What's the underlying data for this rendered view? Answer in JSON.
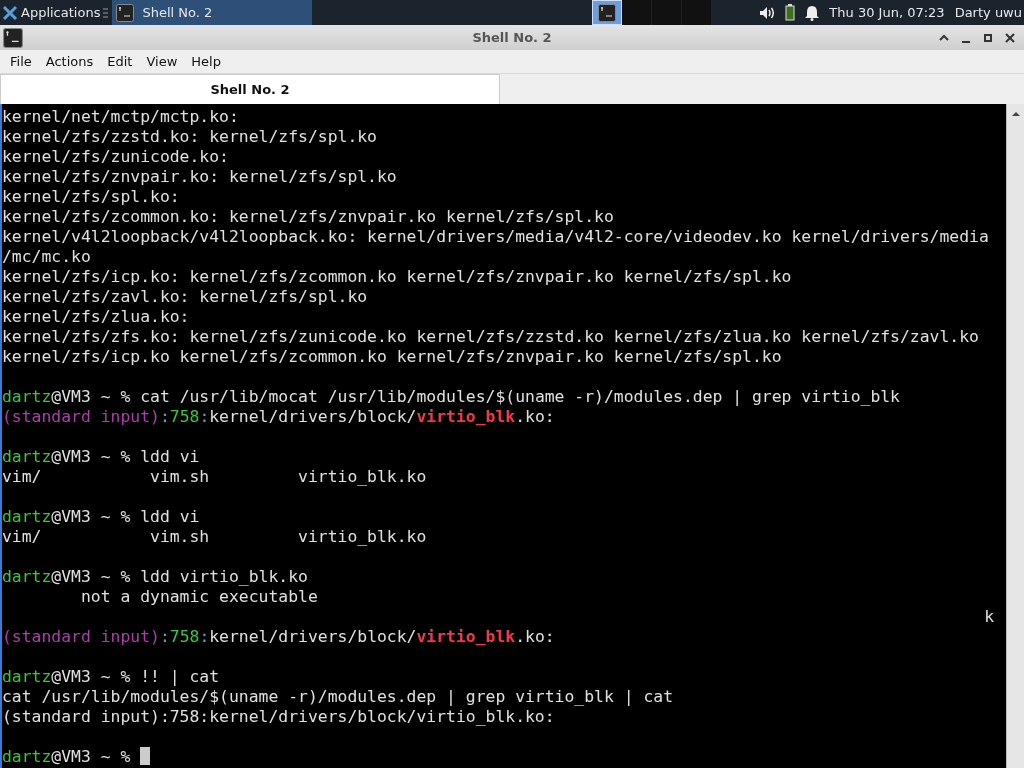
{
  "panel": {
    "apps_label": "Applications",
    "tasks": [
      {
        "label": "Shell No. 2",
        "selected": true
      }
    ],
    "workspaces": [
      {
        "selected": true
      },
      {
        "selected": false
      },
      {
        "selected": false
      },
      {
        "selected": false
      }
    ],
    "clock": "Thu 30 Jun, 07:23",
    "user": "Darty uwu"
  },
  "window": {
    "title": "Shell No. 2"
  },
  "menu": [
    "File",
    "Actions",
    "Edit",
    "View",
    "Help"
  ],
  "tabs": [
    {
      "label": "Shell No. 2",
      "selected": true
    }
  ],
  "terminal": {
    "lines": [
      {
        "kind": "text",
        "segments": [
          {
            "text": "kernel/net/mctp/mctp.ko:",
            "kind": "plain"
          }
        ]
      },
      {
        "kind": "text",
        "segments": [
          {
            "text": "kernel/zfs/zzstd.ko: kernel/zfs/spl.ko",
            "kind": "plain"
          }
        ]
      },
      {
        "kind": "text",
        "segments": [
          {
            "text": "kernel/zfs/zunicode.ko:",
            "kind": "plain"
          }
        ]
      },
      {
        "kind": "text",
        "segments": [
          {
            "text": "kernel/zfs/znvpair.ko: kernel/zfs/spl.ko",
            "kind": "plain"
          }
        ]
      },
      {
        "kind": "text",
        "segments": [
          {
            "text": "kernel/zfs/spl.ko:",
            "kind": "plain"
          }
        ]
      },
      {
        "kind": "text",
        "segments": [
          {
            "text": "kernel/zfs/zcommon.ko: kernel/zfs/znvpair.ko kernel/zfs/spl.ko",
            "kind": "plain"
          }
        ]
      },
      {
        "kind": "text",
        "segments": [
          {
            "text": "kernel/v4l2loopback/v4l2loopback.ko: kernel/drivers/media/v4l2-core/videodev.ko kernel/drivers/media",
            "kind": "plain"
          }
        ]
      },
      {
        "kind": "text",
        "segments": [
          {
            "text": "/mc/mc.ko",
            "kind": "plain"
          }
        ]
      },
      {
        "kind": "text",
        "segments": [
          {
            "text": "kernel/zfs/icp.ko: kernel/zfs/zcommon.ko kernel/zfs/znvpair.ko kernel/zfs/spl.ko",
            "kind": "plain"
          }
        ]
      },
      {
        "kind": "text",
        "segments": [
          {
            "text": "kernel/zfs/zavl.ko: kernel/zfs/spl.ko",
            "kind": "plain"
          }
        ]
      },
      {
        "kind": "text",
        "segments": [
          {
            "text": "kernel/zfs/zlua.ko:",
            "kind": "plain"
          }
        ]
      },
      {
        "kind": "text",
        "segments": [
          {
            "text": "kernel/zfs/zfs.ko: kernel/zfs/zunicode.ko kernel/zfs/zzstd.ko kernel/zfs/zlua.ko kernel/zfs/zavl.ko",
            "kind": "plain"
          }
        ]
      },
      {
        "kind": "text",
        "segments": [
          {
            "text": "kernel/zfs/icp.ko kernel/zfs/zcommon.ko kernel/zfs/znvpair.ko kernel/zfs/spl.ko",
            "kind": "plain"
          }
        ]
      },
      {
        "kind": "blank"
      },
      {
        "kind": "text",
        "segments": [
          {
            "text": "dartz",
            "kind": "user"
          },
          {
            "text": "@VM3 ~ % cat /usr/lib/mocat /usr/lib/modules/$(uname -r)/modules.dep | grep virtio_blk",
            "kind": "plain"
          }
        ]
      },
      {
        "kind": "text",
        "segments": [
          {
            "text": "(standard input)",
            "kind": "file"
          },
          {
            "text": ":",
            "kind": "sep"
          },
          {
            "text": "758",
            "kind": "linenum"
          },
          {
            "text": ":",
            "kind": "sep"
          },
          {
            "text": "kernel/drivers/block/",
            "kind": "plain"
          },
          {
            "text": "virtio_blk",
            "kind": "match"
          },
          {
            "text": ".ko:",
            "kind": "plain"
          }
        ]
      },
      {
        "kind": "blank"
      },
      {
        "kind": "text",
        "segments": [
          {
            "text": "dartz",
            "kind": "user"
          },
          {
            "text": "@VM3 ~ % ldd vi",
            "kind": "plain"
          }
        ]
      },
      {
        "kind": "text",
        "segments": [
          {
            "text": "vim/           vim.sh         virtio_blk.ko",
            "kind": "plain"
          }
        ]
      },
      {
        "kind": "blank"
      },
      {
        "kind": "text",
        "segments": [
          {
            "text": "dartz",
            "kind": "user"
          },
          {
            "text": "@VM3 ~ % ldd vi",
            "kind": "plain"
          }
        ]
      },
      {
        "kind": "text",
        "segments": [
          {
            "text": "vim/           vim.sh         virtio_blk.ko",
            "kind": "plain"
          }
        ]
      },
      {
        "kind": "blank"
      },
      {
        "kind": "text",
        "segments": [
          {
            "text": "dartz",
            "kind": "user"
          },
          {
            "text": "@VM3 ~ % ldd virtio_blk.ko",
            "kind": "plain"
          }
        ]
      },
      {
        "kind": "text",
        "segments": [
          {
            "text": "        not a dynamic executable",
            "kind": "plain"
          }
        ]
      },
      {
        "kind": "right",
        "segments": [
          {
            "text": "k",
            "kind": "plain"
          }
        ]
      },
      {
        "kind": "text",
        "segments": [
          {
            "text": "(standard input)",
            "kind": "file"
          },
          {
            "text": ":",
            "kind": "sep"
          },
          {
            "text": "758",
            "kind": "linenum"
          },
          {
            "text": ":",
            "kind": "sep"
          },
          {
            "text": "kernel/drivers/block/",
            "kind": "plain"
          },
          {
            "text": "virtio_blk",
            "kind": "match"
          },
          {
            "text": ".ko:",
            "kind": "plain"
          }
        ]
      },
      {
        "kind": "blank"
      },
      {
        "kind": "text",
        "segments": [
          {
            "text": "dartz",
            "kind": "user"
          },
          {
            "text": "@VM3 ~ % !! | cat",
            "kind": "plain"
          }
        ]
      },
      {
        "kind": "text",
        "segments": [
          {
            "text": "cat /usr/lib/modules/$(uname -r)/modules.dep | grep virtio_blk | cat",
            "kind": "plain"
          }
        ]
      },
      {
        "kind": "text",
        "segments": [
          {
            "text": "(standard input):758:kernel/drivers/block/virtio_blk.ko:",
            "kind": "plain"
          }
        ]
      },
      {
        "kind": "blank"
      },
      {
        "kind": "prompt",
        "segments": [
          {
            "text": "dartz",
            "kind": "user"
          },
          {
            "text": "@VM3 ~ % ",
            "kind": "plain"
          }
        ]
      }
    ]
  }
}
